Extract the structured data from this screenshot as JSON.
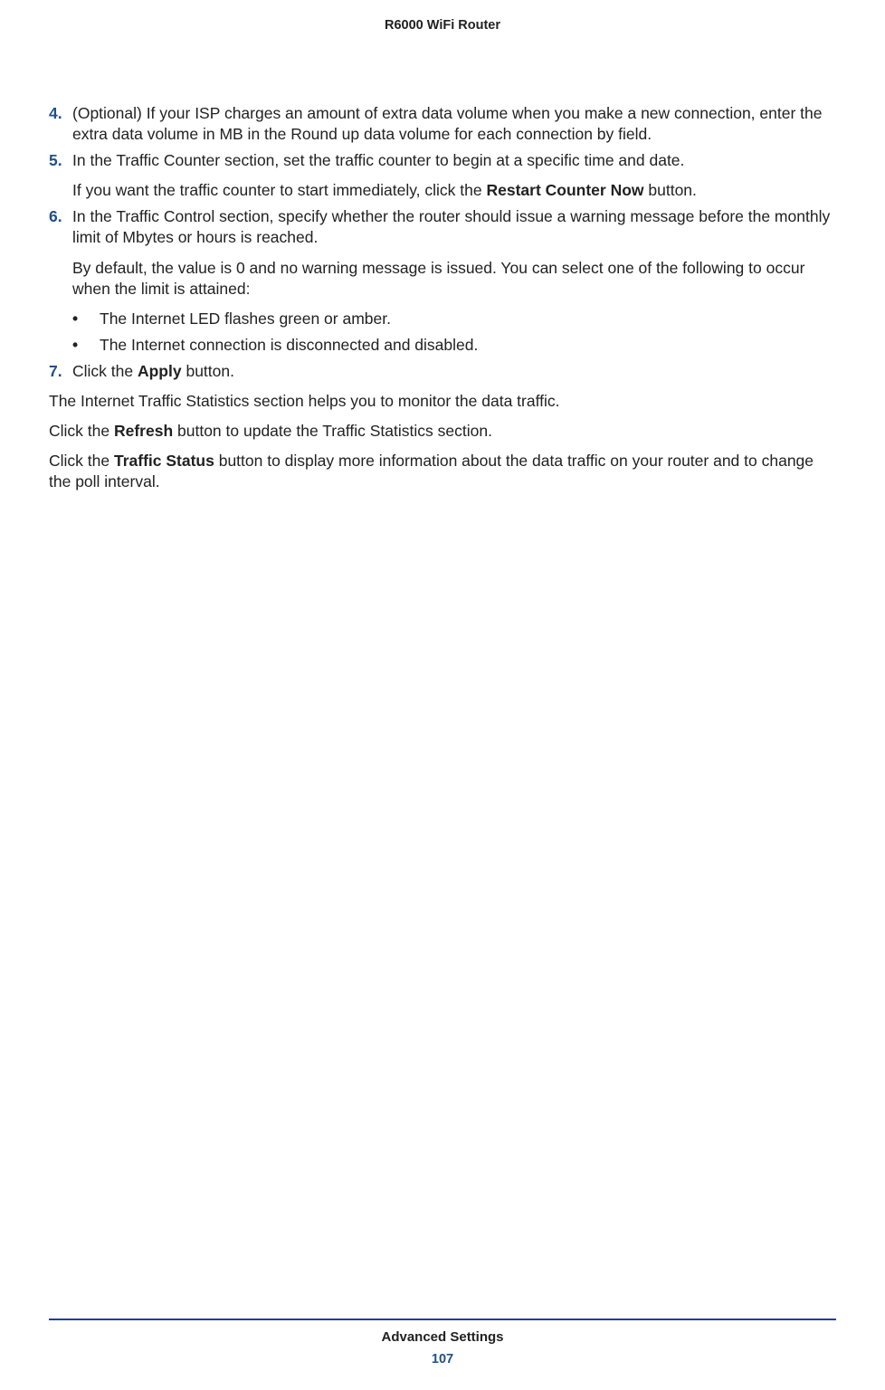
{
  "header": {
    "title": "R6000 WiFi Router"
  },
  "steps": [
    {
      "num": "4.",
      "text": "(Optional) If your ISP charges an amount of extra data volume when you make a new connection, enter the extra data volume in MB in the Round up data volume for each connection by field."
    },
    {
      "num": "5.",
      "text": "In the Traffic Counter section, set the traffic counter to begin at a specific time and date.",
      "sub_pre": "If you want the traffic counter to start immediately, click the ",
      "sub_bold": "Restart Counter Now",
      "sub_post": " button."
    },
    {
      "num": "6.",
      "text": "In the Traffic Control section, specify whether the router should issue a warning message before the monthly limit of Mbytes or hours is reached.",
      "para2": "By default, the value is 0 and no warning message is issued. You can select one of the following to occur when the limit is attained:",
      "bullets": [
        "The Internet LED flashes green or amber.",
        "The Internet connection is disconnected and disabled."
      ]
    },
    {
      "num": "7.",
      "pre": "Click the ",
      "bold": "Apply",
      "post": " button."
    }
  ],
  "after": [
    {
      "plain": "The Internet Traffic Statistics section helps you to monitor the data traffic."
    },
    {
      "pre": "Click the ",
      "bold": "Refresh",
      "post": " button to update the Traffic Statistics section."
    },
    {
      "pre": "Click the ",
      "bold": "Traffic Status",
      "post": " button to display more information about the data traffic on your router and to change the poll interval."
    }
  ],
  "footer": {
    "section": "Advanced Settings",
    "page": "107"
  },
  "bullet_char": "•"
}
